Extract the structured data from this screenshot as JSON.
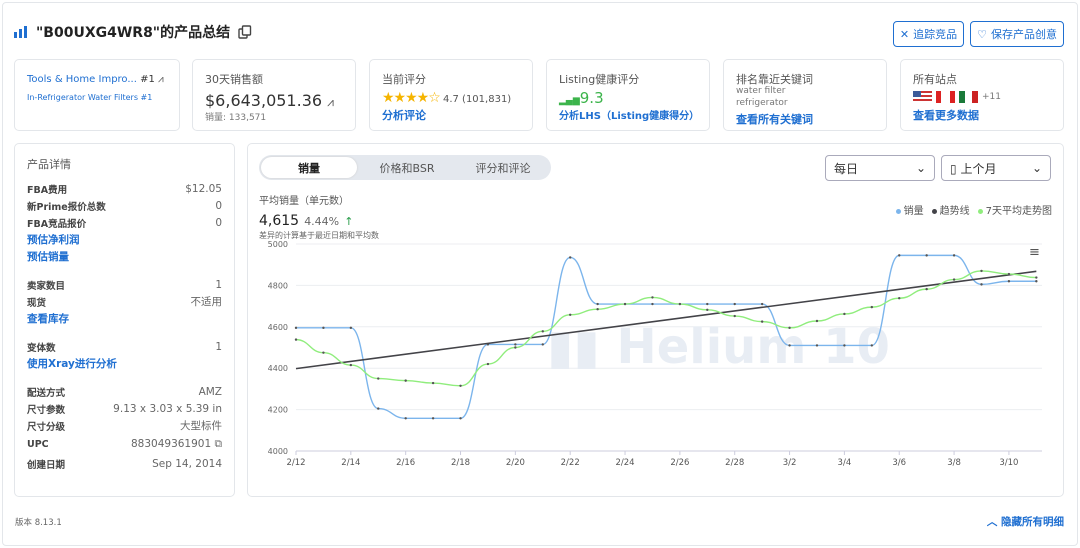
{
  "header": {
    "title": "\"B00UXG4WR8\"的产品总结",
    "track_button": "追踪竞品",
    "save_button": "保存产品创意"
  },
  "stats": {
    "rank": {
      "category": "Tools & Home Impro...",
      "category_rank": "#1",
      "subcategory": "In-Refrigerator Water Filters #1"
    },
    "revenue": {
      "label": "30天销售额",
      "value": "$6,643,051.36",
      "units_label": "销量",
      "units": "133,571"
    },
    "rating": {
      "label": "当前评分",
      "value": "4.7",
      "count": "(101,831)",
      "stars": 4.7,
      "link": "分析评论"
    },
    "lhs": {
      "label": "Listing健康评分",
      "value": "9.3",
      "link": "分析LHS（Listing健康得分）",
      "color": "#3cb44b"
    },
    "keywords": {
      "label": "排名靠近关键词",
      "kw1": "water filter",
      "kw2": "refrigerator",
      "link": "查看所有关键词"
    },
    "marketplaces": {
      "label": "所有站点",
      "flags": [
        "us-flag",
        "ca-flag",
        "mx-flag"
      ],
      "more": "+11",
      "link": "查看更多数据"
    }
  },
  "details": {
    "title": "产品详情",
    "fba_fee": {
      "k": "FBA费用",
      "v": "$12.05"
    },
    "new_prime": {
      "k": "新Prime报价总数",
      "v": "0"
    },
    "fba_offers": {
      "k": "FBA竞品报价",
      "v": "0"
    },
    "link_profit": "预估净利润",
    "link_sales": "预估销量",
    "sellers": {
      "k": "卖家数目",
      "v": "1"
    },
    "stock": {
      "k": "现货",
      "v": "不适用"
    },
    "link_inventory": "查看库存",
    "variants": {
      "k": "变体数",
      "v": "1"
    },
    "link_xray": "使用Xray进行分析",
    "fulfillment": {
      "k": "配送方式",
      "v": "AMZ"
    },
    "dimensions": {
      "k": "尺寸参数",
      "v": "9.13 x 3.03 x 5.39 in"
    },
    "size_tier": {
      "k": "尺寸分级",
      "v": "大型标件"
    },
    "upc": {
      "k": "UPC",
      "v": "883049361901"
    },
    "created": {
      "k": "创建日期",
      "v": "Sep 14, 2014"
    }
  },
  "chart_tabs": [
    "销量",
    "价格和BSR",
    "评分和评论"
  ],
  "interval": "每日",
  "range": "上个月",
  "summary": {
    "label": "平均销量（单元数）",
    "value": "4,615",
    "change": "4.44%",
    "note": "差异的计算基于最近日期和平均数"
  },
  "footer": {
    "version": "版本 8.13.1",
    "hide": "隐藏所有明细"
  },
  "watermark": "Helium 10",
  "chart_data": {
    "type": "line",
    "x": [
      "2/12",
      "2/13",
      "2/14",
      "2/15",
      "2/16",
      "2/17",
      "2/18",
      "2/19",
      "2/20",
      "2/21",
      "2/22",
      "2/23",
      "2/24",
      "2/25",
      "2/26",
      "2/27",
      "2/28",
      "3/1",
      "3/2",
      "3/3",
      "3/4",
      "3/5",
      "3/6",
      "3/7",
      "3/8",
      "3/9",
      "3/10",
      "3/11"
    ],
    "xticks": [
      "2/12",
      "2/14",
      "2/16",
      "2/18",
      "2/20",
      "2/22",
      "2/24",
      "2/26",
      "2/28",
      "3/2",
      "3/4",
      "3/6",
      "3/8",
      "3/10"
    ],
    "yticks": [
      4000,
      4200,
      4400,
      4600,
      4800,
      5000
    ],
    "ylim": [
      4000,
      5000
    ],
    "grid": true,
    "legend": "top-right",
    "series": [
      {
        "name": "销量",
        "color": "#7cb5ec",
        "values": [
          4595,
          4595,
          4595,
          4205,
          4158,
          4158,
          4158,
          4515,
          4515,
          4515,
          4935,
          4710,
          4710,
          4710,
          4710,
          4710,
          4710,
          4710,
          4510,
          4510,
          4510,
          4510,
          4945,
          4945,
          4945,
          4805,
          4820,
          4820
        ]
      },
      {
        "name": "趋势线",
        "color": "#434348",
        "values": [
          4398,
          4415,
          4433,
          4450,
          4468,
          4485,
          4503,
          4520,
          4538,
          4555,
          4573,
          4590,
          4607,
          4625,
          4642,
          4660,
          4677,
          4695,
          4712,
          4729,
          4747,
          4764,
          4782,
          4799,
          4816,
          4834,
          4851,
          4868
        ]
      },
      {
        "name": "7天平均走势图",
        "color": "#90ed7d",
        "values": [
          4538,
          4475,
          4415,
          4350,
          4340,
          4328,
          4315,
          4420,
          4500,
          4578,
          4658,
          4685,
          4710,
          4742,
          4710,
          4682,
          4652,
          4625,
          4595,
          4628,
          4662,
          4695,
          4738,
          4782,
          4828,
          4870,
          4855,
          4838
        ]
      }
    ]
  }
}
